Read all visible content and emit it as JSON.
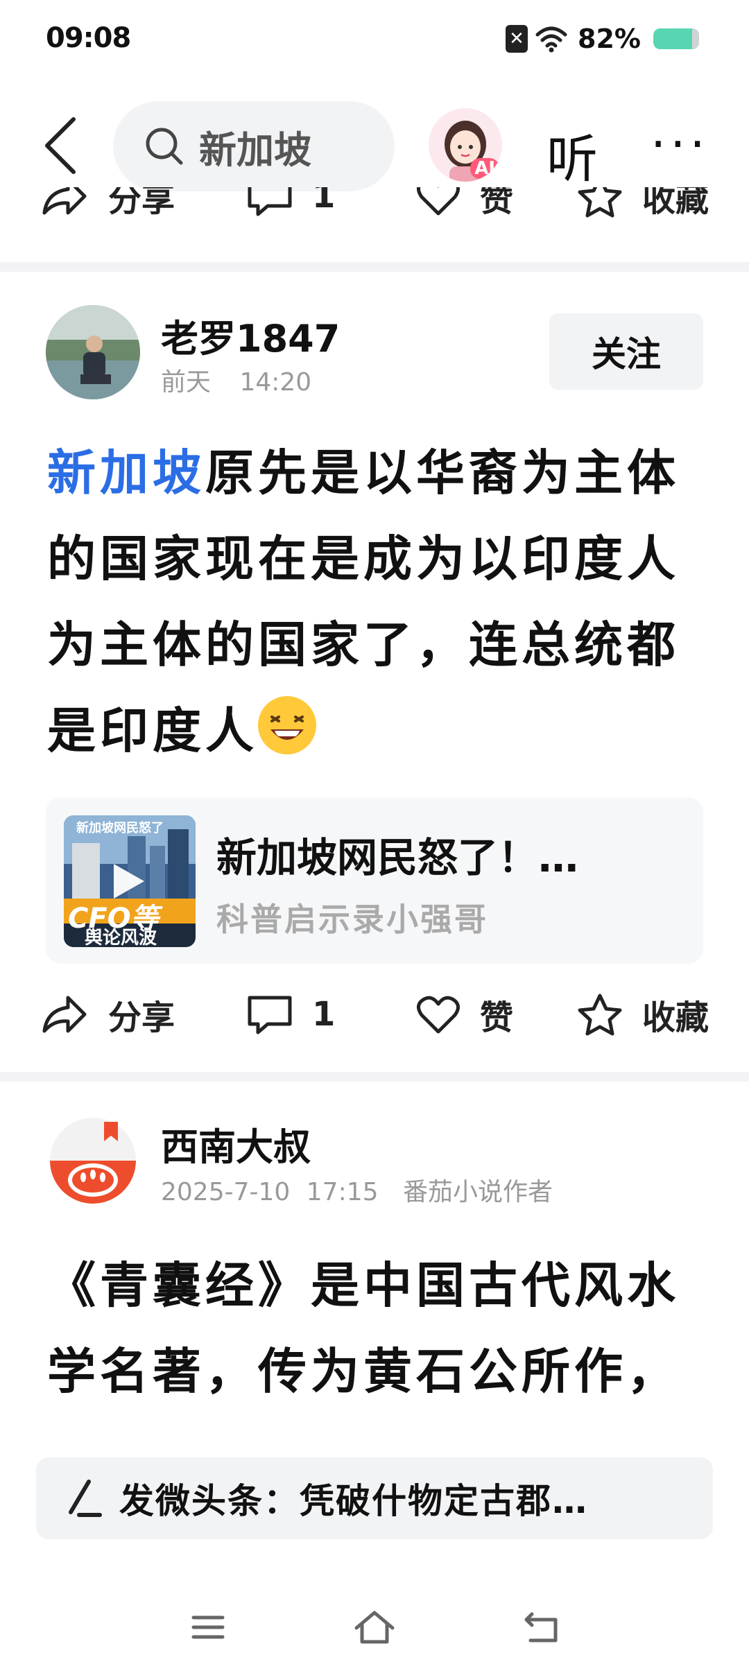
{
  "status_bar": {
    "time": "09:08",
    "battery": "82%",
    "battery_level": 0.82
  },
  "top_nav": {
    "search_query": "新加坡",
    "listen_label": "听",
    "more_label": "···",
    "ai_badge": "AI"
  },
  "partial_actions": {
    "share": "分享",
    "comments": "1",
    "like": "赞",
    "favorite": "收藏"
  },
  "post1": {
    "author": "老罗1847",
    "date": "前天",
    "time": "14:20",
    "follow": "关注",
    "highlight": "新加坡",
    "text": "原先是以华裔为主体的国家现在是成为以印度人为主体的国家了，连总统都是印度人",
    "card": {
      "title": "新加坡网民怒了！…",
      "source": "科普启示录小强哥",
      "thumb_caption": "新加坡网民怒了",
      "thumb_overlay": "CFO等",
      "thumb_overlay2": "舆论风波"
    },
    "actions": {
      "share": "分享",
      "comments": "1",
      "like": "赞",
      "favorite": "收藏"
    }
  },
  "post2": {
    "author": "西南大叔",
    "date": "2025-7-10",
    "time": "17:15",
    "tag": "番茄小说作者",
    "text": "《青囊经》是中国古代风水学名著，传为黄石公所作，"
  },
  "compose": {
    "text": "发微头条：凭破什物定古郡…"
  }
}
